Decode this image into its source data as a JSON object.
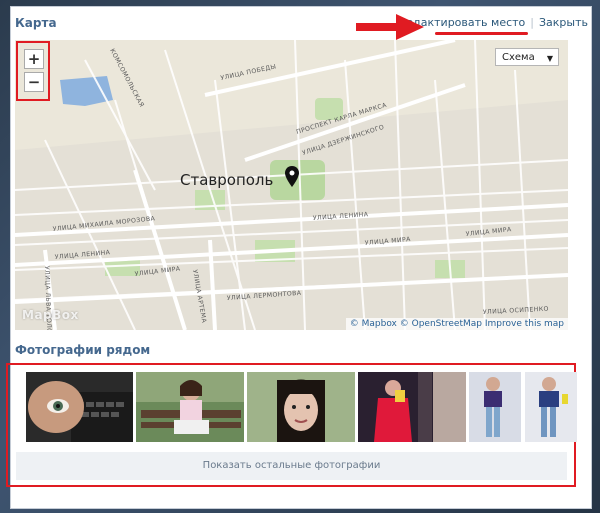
{
  "header": {
    "title": "Карта",
    "edit_link": "Редактировать место",
    "separator": "|",
    "close_link": "Закрыть"
  },
  "map": {
    "zoom_in": "+",
    "zoom_out": "−",
    "layer_select": "Схема",
    "city_label": "Ставрополь",
    "streets": {
      "pobedy": "УЛИЦА ПОБЕДЫ",
      "karla_marksa": "ПРОСПЕКТ КАРЛА МАРКСА",
      "dzerzhinskogo": "УЛИЦА ДЗЕРЖИНСКОГО",
      "morozova": "УЛИЦА МИХАИЛА МОРОЗОВА",
      "lenina1": "УЛИЦА ЛЕНИНА",
      "lenina2": "УЛИЦА ЛЕНИНА",
      "mira1": "УЛИЦА МИРА",
      "mira2": "УЛИЦА МИРА",
      "mira3": "УЛИЦА МИРА",
      "artema": "УЛИЦА АРТЕМА",
      "lermontova": "УЛИЦА ЛЕРМОНТОВА",
      "osipenko": "УЛИЦА ОСИПЕНКО",
      "lva_tolstogo": "УЛИЦА ЛЬВА ТОЛСТОГО",
      "komsomolskaya": "КОМСОМОЛЬСКАЯ"
    },
    "attribution": "© Mapbox © OpenStreetMap Improve this map",
    "logo": "MapBox"
  },
  "photos": {
    "title": "Фотографии рядом",
    "show_more": "Показать остальные фотографии"
  },
  "colors": {
    "link": "#2b587a",
    "heading": "#45688e",
    "highlight": "#e01b22"
  }
}
